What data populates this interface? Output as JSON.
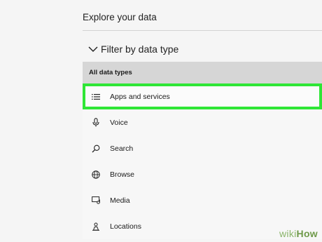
{
  "section": {
    "title": "Explore your data"
  },
  "filter": {
    "label": "Filter by data type"
  },
  "list": {
    "header": "All data types",
    "items": [
      {
        "label": "Apps and services",
        "icon": "list-icon",
        "selected": true
      },
      {
        "label": "Voice",
        "icon": "microphone-icon",
        "selected": false
      },
      {
        "label": "Search",
        "icon": "search-icon",
        "selected": false
      },
      {
        "label": "Browse",
        "icon": "globe-icon",
        "selected": false
      },
      {
        "label": "Media",
        "icon": "media-icon",
        "selected": false
      },
      {
        "label": "Locations",
        "icon": "location-person-icon",
        "selected": false
      }
    ]
  },
  "watermark": {
    "prefix": "wiki",
    "suffix": "How"
  },
  "colors": {
    "highlight": "#2fe636",
    "header_bg": "#d6d6d6"
  }
}
